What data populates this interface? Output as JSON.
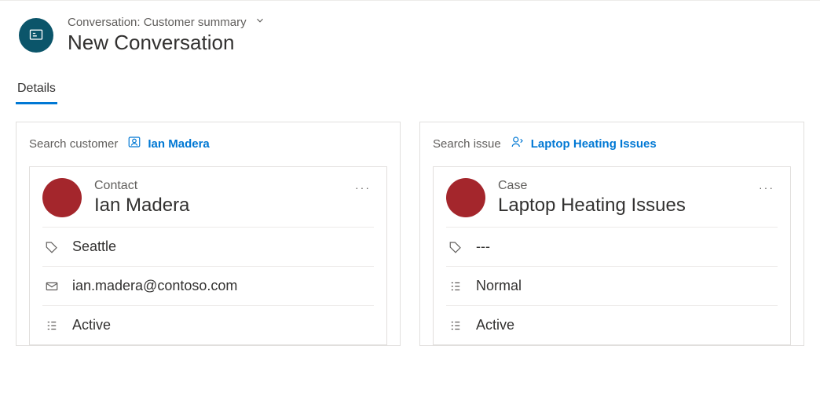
{
  "header": {
    "breadcrumb": "Conversation: Customer summary",
    "title": "New Conversation"
  },
  "tabs": {
    "details": "Details"
  },
  "customer": {
    "search_label": "Search customer",
    "link": "Ian Madera",
    "card": {
      "type": "Contact",
      "name": "Ian Madera",
      "location": "Seattle",
      "email": "ian.madera@contoso.com",
      "status": "Active"
    }
  },
  "issue": {
    "search_label": "Search issue",
    "link": "Laptop Heating Issues",
    "card": {
      "type": "Case",
      "name": "Laptop Heating Issues",
      "location": "---",
      "priority": "Normal",
      "status": "Active"
    }
  }
}
